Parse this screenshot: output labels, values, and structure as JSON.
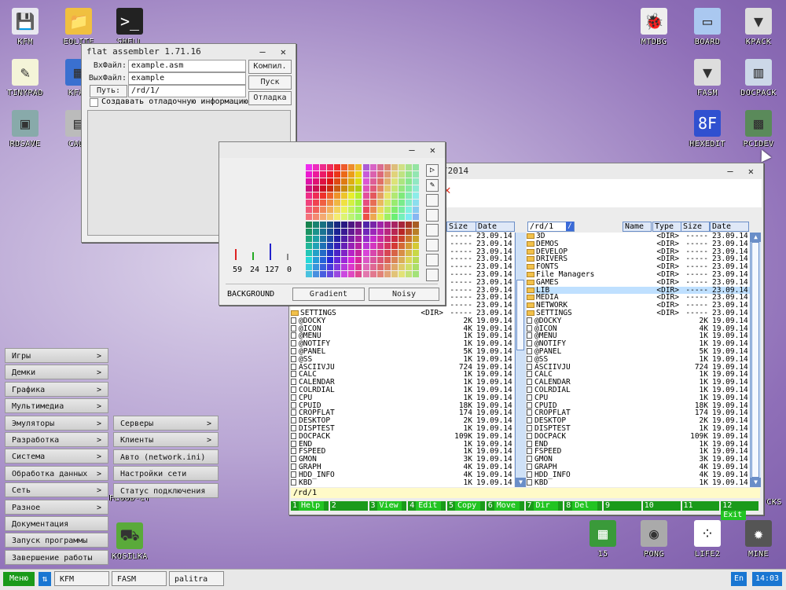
{
  "desktop_icons": [
    {
      "label": "KFM",
      "glyph": "💾"
    },
    {
      "label": "EOLITE",
      "glyph": "📁"
    },
    {
      "label": "SHELL",
      "glyph": ">_"
    },
    {
      "label": "TINYPAD",
      "glyph": "✎"
    },
    {
      "label": "KFAR",
      "glyph": "▦"
    },
    {
      "label": "RDSAVE",
      "glyph": "▣"
    },
    {
      "label": "CALC",
      "glyph": "▤"
    },
    {
      "label": "MTDBG",
      "glyph": "🐞"
    },
    {
      "label": "BOARD",
      "glyph": "▭"
    },
    {
      "label": "KPACK",
      "glyph": "▼"
    },
    {
      "label": "FASM",
      "glyph": "▼"
    },
    {
      "label": "DOCPACK",
      "glyph": "▥"
    },
    {
      "label": "HEXEDIT",
      "glyph": "8F"
    },
    {
      "label": "PCIDEV",
      "glyph": "▩"
    },
    {
      "label": "FLOOD-IT",
      "glyph": ""
    },
    {
      "label": "KOSILKA",
      "glyph": "⛟"
    },
    {
      "label": "15",
      "glyph": "▦"
    },
    {
      "label": "PONG",
      "glyph": "◉"
    },
    {
      "label": "LIFE2",
      "glyph": "⁘"
    },
    {
      "label": "MINE",
      "glyph": "✹"
    },
    {
      "label": "CKS",
      "glyph": ""
    }
  ],
  "fasm": {
    "title": "flat assembler 1.71.16",
    "in_label": "ВхФайл:",
    "in_value": "example.asm",
    "out_label": "ВыхФайл:",
    "out_value": "example",
    "path_label": "Путь:",
    "path_value": "/rd/1/",
    "debug_label": "Создавать отладочную информацию",
    "compile_btn": "Компил.",
    "run_btn": "Пуск",
    "debug_btn": "Отладка"
  },
  "palitra": {
    "values": [
      "59",
      "24",
      "127",
      "0"
    ],
    "background_label": "BACKGROUND",
    "gradient_btn": "Gradient",
    "noisy_btn": "Noisy"
  },
  "kfm": {
    "title_fragment": "/2014",
    "left_headers": {
      "size": "Size",
      "date": "Date"
    },
    "right_path": "/rd/1",
    "right_headers": {
      "name": "Name",
      "type": "Type",
      "size": "Size",
      "date": "Date"
    },
    "status_path": "/rd/1",
    "left_rows": [
      {
        "name": "",
        "size": "-----",
        "date": "23.09.14"
      },
      {
        "name": "",
        "size": "-----",
        "date": "23.09.14"
      },
      {
        "name": "",
        "size": "-----",
        "date": "23.09.14"
      },
      {
        "name": "",
        "size": "-----",
        "date": "23.09.14"
      },
      {
        "name": "",
        "size": "-----",
        "date": "23.09.14"
      },
      {
        "name": "",
        "size": "-----",
        "date": "23.09.14"
      },
      {
        "name": "",
        "size": "-----",
        "date": "23.09.14"
      },
      {
        "name": "",
        "size": "-----",
        "date": "23.09.14"
      },
      {
        "name": "",
        "size": "-----",
        "date": "23.09.14"
      },
      {
        "name": "",
        "size": "-----",
        "date": "23.09.14"
      },
      {
        "name": "SETTINGS",
        "type": "<DIR>",
        "size": "-----",
        "date": "23.09.14",
        "dir": true
      },
      {
        "name": "@DOCKY",
        "size": "2K",
        "date": "19.09.14"
      },
      {
        "name": "@ICON",
        "size": "4K",
        "date": "19.09.14"
      },
      {
        "name": "@MENU",
        "size": "1K",
        "date": "19.09.14"
      },
      {
        "name": "@NOTIFY",
        "size": "1K",
        "date": "19.09.14"
      },
      {
        "name": "@PANEL",
        "size": "5K",
        "date": "19.09.14"
      },
      {
        "name": "@SS",
        "size": "1K",
        "date": "19.09.14"
      },
      {
        "name": "ASCIIVJU",
        "size": "724",
        "date": "19.09.14"
      },
      {
        "name": "CALC",
        "size": "1K",
        "date": "19.09.14"
      },
      {
        "name": "CALENDAR",
        "size": "1K",
        "date": "19.09.14"
      },
      {
        "name": "COLRDIAL",
        "size": "1K",
        "date": "19.09.14"
      },
      {
        "name": "CPU",
        "size": "1K",
        "date": "19.09.14"
      },
      {
        "name": "CPUID",
        "size": "18K",
        "date": "19.09.14"
      },
      {
        "name": "CROPFLAT",
        "size": "174",
        "date": "19.09.14"
      },
      {
        "name": "DESKTOP",
        "size": "2K",
        "date": "19.09.14"
      },
      {
        "name": "DISPTEST",
        "size": "1K",
        "date": "19.09.14"
      },
      {
        "name": "DOCPACK",
        "size": "109K",
        "date": "19.09.14"
      },
      {
        "name": "END",
        "size": "1K",
        "date": "19.09.14"
      },
      {
        "name": "FSPEED",
        "size": "1K",
        "date": "19.09.14"
      },
      {
        "name": "GMON",
        "size": "3K",
        "date": "19.09.14"
      },
      {
        "name": "GRAPH",
        "size": "4K",
        "date": "19.09.14"
      },
      {
        "name": "HDD_INFO",
        "size": "4K",
        "date": "19.09.14"
      },
      {
        "name": "KBD",
        "size": "1K",
        "date": "19.09.14"
      }
    ],
    "right_rows": [
      {
        "name": "3D",
        "type": "<DIR>",
        "size": "-----",
        "date": "23.09.14",
        "dir": true
      },
      {
        "name": "DEMOS",
        "type": "<DIR>",
        "size": "-----",
        "date": "23.09.14",
        "dir": true
      },
      {
        "name": "DEVELOP",
        "type": "<DIR>",
        "size": "-----",
        "date": "23.09.14",
        "dir": true
      },
      {
        "name": "DRIVERS",
        "type": "<DIR>",
        "size": "-----",
        "date": "23.09.14",
        "dir": true
      },
      {
        "name": "FONTS",
        "type": "<DIR>",
        "size": "-----",
        "date": "23.09.14",
        "dir": true
      },
      {
        "name": "File Managers",
        "type": "<DIR>",
        "size": "-----",
        "date": "23.09.14",
        "dir": true
      },
      {
        "name": "GAMES",
        "type": "<DIR>",
        "size": "-----",
        "date": "23.09.14",
        "dir": true
      },
      {
        "name": "LIB",
        "type": "<DIR>",
        "size": "-----",
        "date": "23.09.14",
        "dir": true,
        "selected": true
      },
      {
        "name": "MEDIA",
        "type": "<DIR>",
        "size": "-----",
        "date": "23.09.14",
        "dir": true
      },
      {
        "name": "NETWORK",
        "type": "<DIR>",
        "size": "-----",
        "date": "23.09.14",
        "dir": true
      },
      {
        "name": "SETTINGS",
        "type": "<DIR>",
        "size": "-----",
        "date": "23.09.14",
        "dir": true
      },
      {
        "name": "@DOCKY",
        "size": "2K",
        "date": "19.09.14"
      },
      {
        "name": "@ICON",
        "size": "4K",
        "date": "19.09.14"
      },
      {
        "name": "@MENU",
        "size": "1K",
        "date": "19.09.14"
      },
      {
        "name": "@NOTIFY",
        "size": "1K",
        "date": "19.09.14"
      },
      {
        "name": "@PANEL",
        "size": "5K",
        "date": "19.09.14"
      },
      {
        "name": "@SS",
        "size": "1K",
        "date": "19.09.14"
      },
      {
        "name": "ASCIIVJU",
        "size": "724",
        "date": "19.09.14"
      },
      {
        "name": "CALC",
        "size": "1K",
        "date": "19.09.14"
      },
      {
        "name": "CALENDAR",
        "size": "1K",
        "date": "19.09.14"
      },
      {
        "name": "COLRDIAL",
        "size": "1K",
        "date": "19.09.14"
      },
      {
        "name": "CPU",
        "size": "1K",
        "date": "19.09.14"
      },
      {
        "name": "CPUID",
        "size": "18K",
        "date": "19.09.14"
      },
      {
        "name": "CROPFLAT",
        "size": "174",
        "date": "19.09.14"
      },
      {
        "name": "DESKTOP",
        "size": "2K",
        "date": "19.09.14"
      },
      {
        "name": "DISPTEST",
        "size": "1K",
        "date": "19.09.14"
      },
      {
        "name": "DOCPACK",
        "size": "109K",
        "date": "19.09.14"
      },
      {
        "name": "END",
        "size": "1K",
        "date": "19.09.14"
      },
      {
        "name": "FSPEED",
        "size": "1K",
        "date": "19.09.14"
      },
      {
        "name": "GMON",
        "size": "3K",
        "date": "19.09.14"
      },
      {
        "name": "GRAPH",
        "size": "4K",
        "date": "19.09.14"
      },
      {
        "name": "HDD_INFO",
        "size": "4K",
        "date": "19.09.14"
      },
      {
        "name": "KBD",
        "size": "1K",
        "date": "19.09.14"
      }
    ],
    "fkeys": [
      {
        "n": "1",
        "l": "Help"
      },
      {
        "n": "2",
        "l": ""
      },
      {
        "n": "3",
        "l": "View"
      },
      {
        "n": "4",
        "l": "Edit"
      },
      {
        "n": "5",
        "l": "Copy"
      },
      {
        "n": "6",
        "l": "Move"
      },
      {
        "n": "7",
        "l": "Dir"
      },
      {
        "n": "8",
        "l": "Del"
      },
      {
        "n": "9",
        "l": ""
      },
      {
        "n": "10",
        "l": ""
      },
      {
        "n": "11",
        "l": ""
      },
      {
        "n": "12",
        "l": "Exit"
      }
    ]
  },
  "start_menu": {
    "items": [
      {
        "label": "Игры",
        "sub": true
      },
      {
        "label": "Демки",
        "sub": true
      },
      {
        "label": "Графика",
        "sub": true
      },
      {
        "label": "Мультимедиа",
        "sub": true
      },
      {
        "label": "Эмуляторы",
        "sub": true
      },
      {
        "label": "Разработка",
        "sub": true
      },
      {
        "label": "Система",
        "sub": true
      },
      {
        "label": "Обработка данных",
        "sub": true
      },
      {
        "label": "Сеть",
        "sub": true
      },
      {
        "label": "Разное",
        "sub": true
      },
      {
        "label": "Документация",
        "sub": false
      },
      {
        "label": "Запуск программы",
        "sub": false
      },
      {
        "label": "Завершение работы",
        "sub": false
      }
    ],
    "submenu": [
      {
        "label": "Серверы",
        "sub": true
      },
      {
        "label": "Клиенты",
        "sub": true
      },
      {
        "label": "Авто (network.ini)",
        "sub": false
      },
      {
        "label": "Настройки сети",
        "sub": false
      },
      {
        "label": "Статус подключения",
        "sub": false
      }
    ]
  },
  "taskbar": {
    "menu_btn": "Меню",
    "tasks": [
      "KFM",
      "FASM",
      "palitra"
    ],
    "lang": "En",
    "time": "14:03"
  },
  "colors": {
    "accent_green": "#1a9a1a",
    "taskbar_blue": "#1976d2",
    "selection": "#bfe0ff"
  }
}
